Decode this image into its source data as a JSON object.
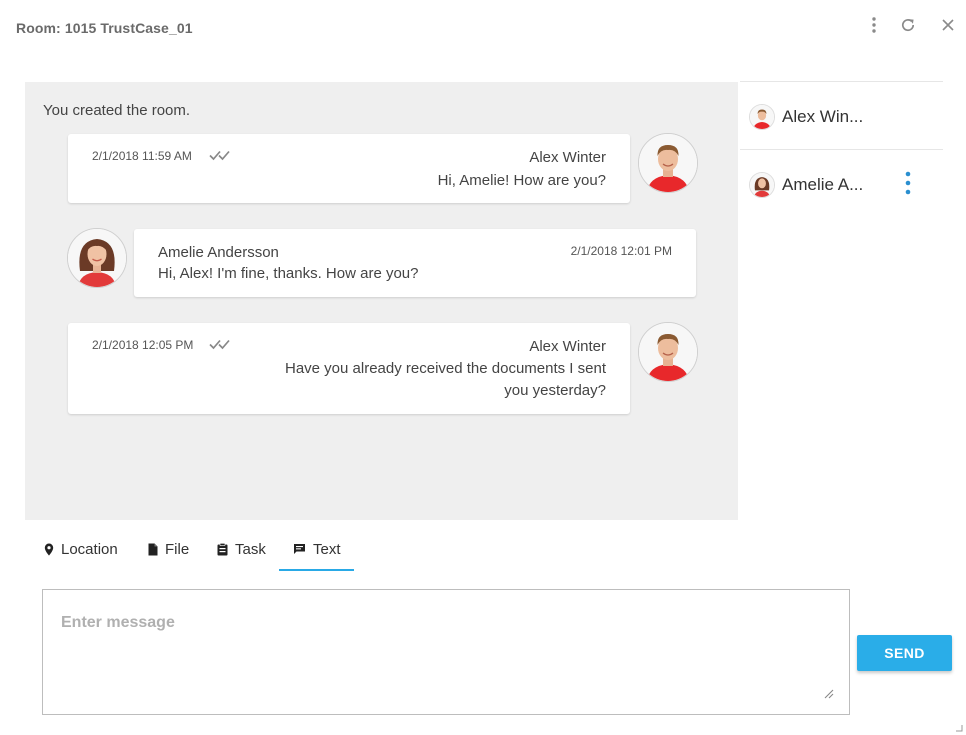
{
  "window": {
    "title": "Room: 1015 TrustCase_01"
  },
  "chat": {
    "system_message": "You created the room.",
    "messages": [
      {
        "sender": "Alex Winter",
        "timestamp": "2/1/2018 11:59 AM",
        "text": "Hi, Amelie! How are you?",
        "outgoing": true
      },
      {
        "sender": "Amelie Andersson",
        "timestamp": "2/1/2018 12:01 PM",
        "text": "Hi, Alex! I'm fine, thanks. How are you?",
        "outgoing": false
      },
      {
        "sender": "Alex Winter",
        "timestamp": "2/1/2018 12:05 PM",
        "text_line1": "Have you already received the documents I sent",
        "text_line2": "you yesterday?",
        "outgoing": true
      }
    ]
  },
  "members": [
    {
      "name": "Alex Win..."
    },
    {
      "name": "Amelie A..."
    }
  ],
  "tabs": [
    {
      "label": "Location",
      "icon": "location-pin-icon"
    },
    {
      "label": "File",
      "icon": "file-icon"
    },
    {
      "label": "Task",
      "icon": "clipboard-icon"
    },
    {
      "label": "Text",
      "icon": "chat-bubble-icon",
      "active": true
    }
  ],
  "composer": {
    "placeholder": "Enter message",
    "value": "",
    "send_label": "SEND"
  },
  "colors": {
    "accent": "#2aade8",
    "chat_background": "#efefef",
    "avatar_shirt": "#e8282b"
  }
}
